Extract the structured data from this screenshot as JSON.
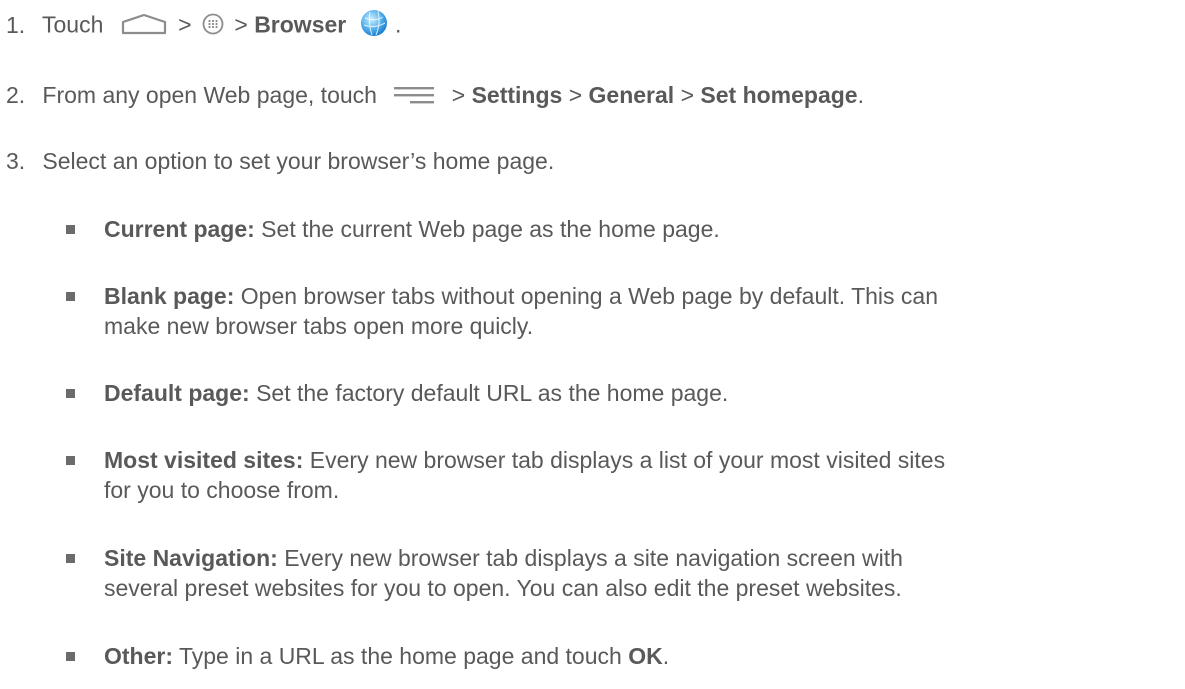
{
  "steps": [
    {
      "num": "1.",
      "parts": {
        "touch": "Touch",
        "sep1": ">",
        "sep2": ">",
        "browser": "Browser",
        "end": "."
      },
      "icons": [
        "home-icon",
        "apps-icon",
        "browser-globe-icon"
      ]
    },
    {
      "num": "2.",
      "parts": {
        "text": "From any open Web page, touch",
        "sep1": ">",
        "settings": "Settings",
        "sep2": ">",
        "general": "General",
        "sep3": ">",
        "set_homepage": "Set homepage",
        "end": "."
      },
      "icons": [
        "menu-icon"
      ]
    },
    {
      "num": "3.",
      "text": "Select an option to set your browser’s home page."
    }
  ],
  "options": [
    {
      "label": "Current page:",
      "desc": " Set the current Web page as the home page."
    },
    {
      "label": "Blank page:",
      "desc": " Open browser tabs without opening a Web page by default. This can",
      "desc2": "make new browser tabs open more quicly."
    },
    {
      "label": "Default page:",
      "desc": " Set the factory default URL as the home page."
    },
    {
      "label": "Most visited sites:",
      "desc": " Every new browser tab displays a list of your most visited sites",
      "desc2": "for you to choose from."
    },
    {
      "label": "Site Navigation:",
      "desc": " Every new browser tab displays a site navigation screen with",
      "desc2": "several preset websites for you to open. You can also edit the preset websites."
    },
    {
      "label": "Other:",
      "desc": " Type in a URL as the home page and touch ",
      "ok": "OK",
      "end": "."
    }
  ],
  "colors": {
    "text": "#595959",
    "bullet": "#6b6b6b",
    "globe_light": "#8fd0f5",
    "globe_dark": "#1c7fd0"
  }
}
